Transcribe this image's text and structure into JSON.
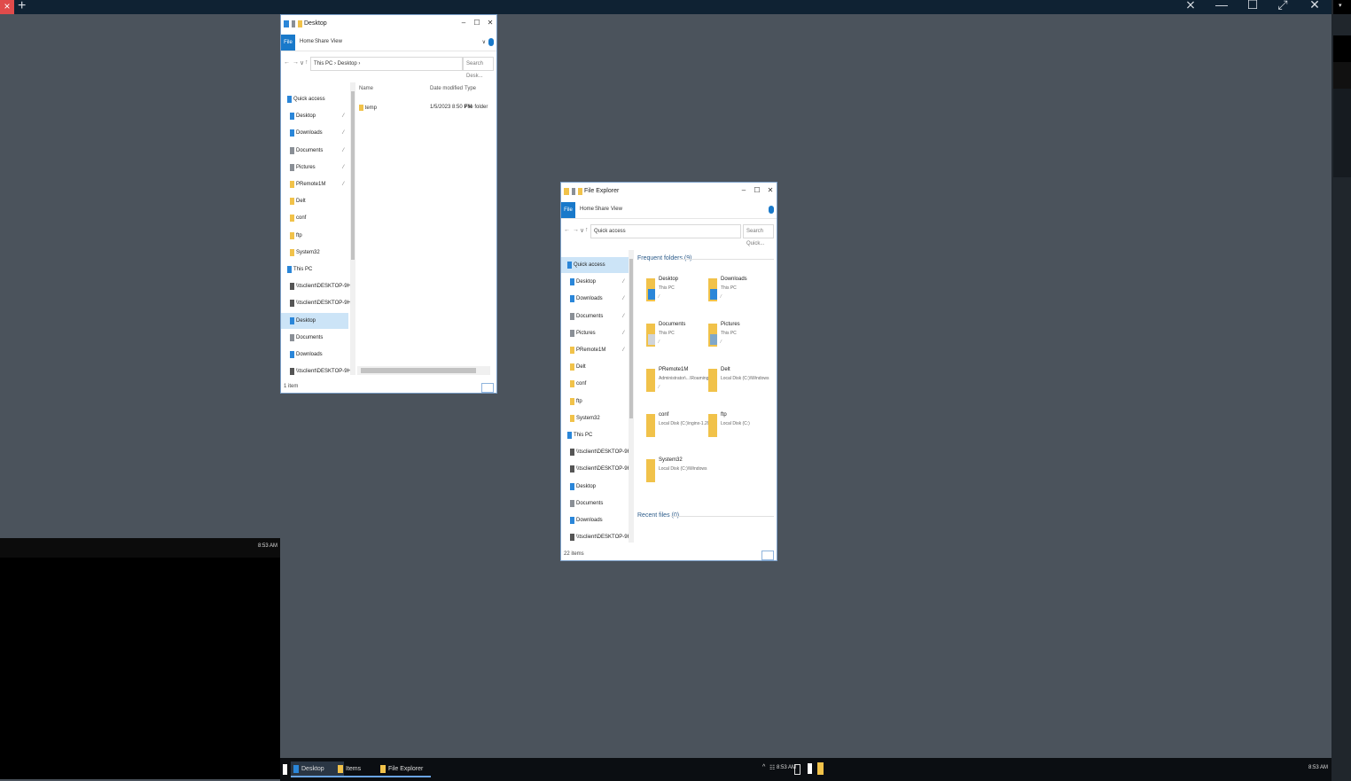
{
  "colors": {
    "desktop_bg": "#4b535c",
    "accent": "#1979ca",
    "folder": "#f1c24a",
    "selected_nav": "#cce4f7",
    "taskbar": "#0b0e12"
  },
  "remote_bar": {
    "close_symbol": "×",
    "plus_symbol": "+",
    "controls": [
      "⨯",
      "—",
      "☐",
      "⤢",
      "✕"
    ]
  },
  "black_pane": {
    "clock": "8:53 AM"
  },
  "win1": {
    "title": "Desktop",
    "controls": [
      "–",
      "☐",
      "✕"
    ],
    "ribbon": {
      "file": "File",
      "tabs": [
        "Home",
        "Share",
        "View"
      ]
    },
    "address": {
      "path": "This PC › Desktop ›",
      "search_placeholder": "Search Desk..."
    },
    "columns": [
      "Name",
      "Date modified",
      "Type"
    ],
    "files": [
      {
        "name": "temp",
        "date": "1/5/2023 8:50 PM",
        "type": "File folder"
      }
    ],
    "nav": [
      {
        "label": "Quick access",
        "icon": "star-icon",
        "pin": false
      },
      {
        "label": "Desktop",
        "icon": "desktop-icon",
        "pin": true
      },
      {
        "label": "Downloads",
        "icon": "download-icon",
        "pin": true
      },
      {
        "label": "Documents",
        "icon": "document-icon",
        "pin": true
      },
      {
        "label": "Pictures",
        "icon": "picture-icon",
        "pin": true
      },
      {
        "label": "PRemote1M",
        "icon": "folder-icon",
        "pin": true
      },
      {
        "label": "Delt",
        "icon": "folder-icon",
        "pin": false
      },
      {
        "label": "conf",
        "icon": "folder-icon",
        "pin": false
      },
      {
        "label": "ftp",
        "icon": "folder-icon",
        "pin": false
      },
      {
        "label": "System32",
        "icon": "folder-icon",
        "pin": false
      },
      {
        "label": "This PC",
        "icon": "pc-icon",
        "pin": false
      },
      {
        "label": "\\\\tsclient\\DESKTOP-9H8OTN8",
        "icon": "drive-icon",
        "pin": false
      },
      {
        "label": "\\\\tsclient\\DESKTOP-9H8OTN8",
        "icon": "drive-icon",
        "pin": false
      },
      {
        "label": "Desktop",
        "icon": "desktop-icon",
        "pin": false,
        "selected": true
      },
      {
        "label": "Documents",
        "icon": "document-icon",
        "pin": false
      },
      {
        "label": "Downloads",
        "icon": "download-icon",
        "pin": false
      },
      {
        "label": "\\\\tsclient\\DESKTOP-9H8OTN8",
        "icon": "drive-icon",
        "pin": false
      }
    ],
    "status": "1 item"
  },
  "win2": {
    "title": "File Explorer",
    "controls": [
      "–",
      "☐",
      "✕"
    ],
    "ribbon": {
      "file": "File",
      "tabs": [
        "Home",
        "Share",
        "View"
      ]
    },
    "address": {
      "path": "Quick access",
      "search_placeholder": "Search Quick..."
    },
    "nav": [
      {
        "label": "Quick access",
        "icon": "star-icon",
        "pin": false,
        "selected": true
      },
      {
        "label": "Desktop",
        "icon": "desktop-icon",
        "pin": true
      },
      {
        "label": "Downloads",
        "icon": "download-icon",
        "pin": true
      },
      {
        "label": "Documents",
        "icon": "document-icon",
        "pin": true
      },
      {
        "label": "Pictures",
        "icon": "picture-icon",
        "pin": true
      },
      {
        "label": "PRemote1M",
        "icon": "folder-icon",
        "pin": true
      },
      {
        "label": "Delt",
        "icon": "folder-icon",
        "pin": false
      },
      {
        "label": "conf",
        "icon": "folder-icon",
        "pin": false
      },
      {
        "label": "ftp",
        "icon": "folder-icon",
        "pin": false
      },
      {
        "label": "System32",
        "icon": "folder-icon",
        "pin": false
      },
      {
        "label": "This PC",
        "icon": "pc-icon",
        "pin": false
      },
      {
        "label": "\\\\tsclient\\DESKTOP-9H8OTN8",
        "icon": "drive-icon",
        "pin": false
      },
      {
        "label": "\\\\tsclient\\DESKTOP-9H8OTN8",
        "icon": "drive-icon",
        "pin": false
      },
      {
        "label": "Desktop",
        "icon": "desktop-icon",
        "pin": false
      },
      {
        "label": "Documents",
        "icon": "document-icon",
        "pin": false
      },
      {
        "label": "Downloads",
        "icon": "download-icon",
        "pin": false
      },
      {
        "label": "\\\\tsclient\\DESKTOP-9H8OTN8",
        "icon": "drive-icon",
        "pin": false
      }
    ],
    "frequent_header": "Frequent folders (9)",
    "recent_header": "Recent files (0)",
    "tiles": [
      {
        "name": "Desktop",
        "sub": "This PC",
        "pin": "📌",
        "overlay": "desktop"
      },
      {
        "name": "Downloads",
        "sub": "This PC",
        "pin": "📌",
        "overlay": "download"
      },
      {
        "name": "Documents",
        "sub": "This PC",
        "pin": "📌",
        "overlay": "document"
      },
      {
        "name": "Pictures",
        "sub": "This PC",
        "pin": "📌",
        "overlay": "picture"
      },
      {
        "name": "PRemote1M",
        "sub": "Administrator\\...\\Roaming",
        "pin": "📌",
        "overlay": ""
      },
      {
        "name": "Delt",
        "sub": "Local Disk (C:)\\Windows",
        "pin": "",
        "overlay": ""
      },
      {
        "name": "conf",
        "sub": "Local Disk (C:)\\nginx-1.20.2",
        "pin": "",
        "overlay": ""
      },
      {
        "name": "ftp",
        "sub": "Local Disk (C:)",
        "pin": "",
        "overlay": ""
      },
      {
        "name": "System32",
        "sub": "Local Disk (C:)\\Windows",
        "pin": "",
        "overlay": ""
      }
    ],
    "status": "22 items"
  },
  "taskbar": {
    "items": [
      {
        "label": "Desktop",
        "active": true
      },
      {
        "label": "Items",
        "active": false
      },
      {
        "label": "File Explorer",
        "active": false
      }
    ],
    "tray": {
      "chevron": "^",
      "clock": "8:53 AM"
    },
    "right_clock": "8:53 AM"
  }
}
